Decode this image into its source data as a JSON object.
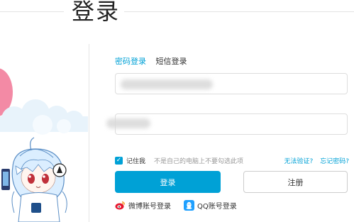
{
  "page": {
    "title": "登录"
  },
  "tabs": [
    {
      "label": "密码登录",
      "active": true
    },
    {
      "label": "短信登录",
      "active": false
    }
  ],
  "form": {
    "username_placeholder": "",
    "password_placeholder": ""
  },
  "remember": {
    "checked": true,
    "label": "记住我",
    "hint": "不是自己的电脑上不要勾选此项"
  },
  "links": {
    "cannot_verify": "无法验证?",
    "forgot_password": "忘记密码?"
  },
  "buttons": {
    "login": "登录",
    "register": "注册"
  },
  "social": {
    "weibo": "微博账号登录",
    "qq": "QQ账号登录"
  },
  "colors": {
    "accent": "#00a1d6",
    "qq_blue": "#1ea0ff",
    "weibo_red": "#e6162d"
  }
}
